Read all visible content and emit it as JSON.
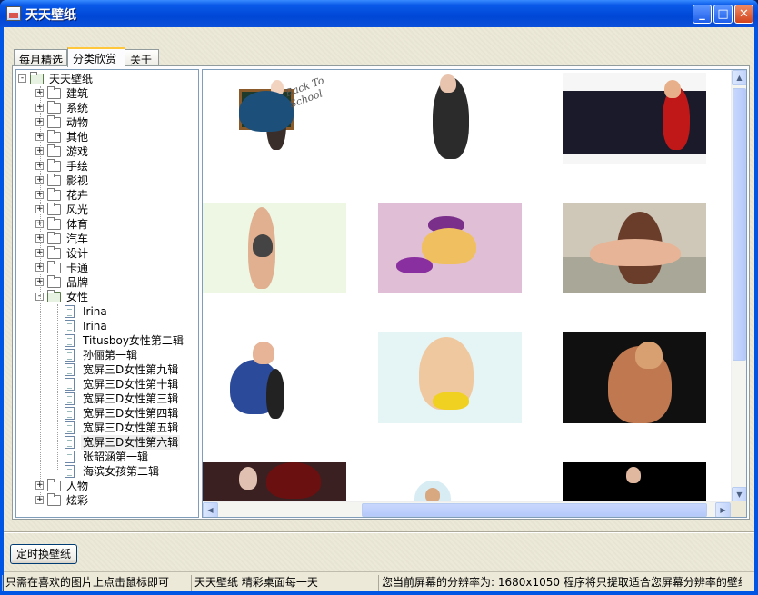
{
  "window": {
    "title": "天天壁纸",
    "minimize_glyph": "_",
    "maximize_glyph": "□",
    "close_glyph": "✕"
  },
  "tabs": [
    {
      "label": "每月精选"
    },
    {
      "label": "分类欣赏"
    },
    {
      "label": "关于"
    }
  ],
  "tree": {
    "root": "天天壁纸",
    "categories": [
      "建筑",
      "系统",
      "动物",
      "其他",
      "游戏",
      "手绘",
      "影视",
      "花卉",
      "风光",
      "体育",
      "汽车",
      "设计",
      "卡通",
      "品牌"
    ],
    "expanded": {
      "label": "女性",
      "children": [
        "Irina",
        "Irina",
        "Titusboy女性第二辑",
        "孙俪第一辑",
        "宽屏三D女性第九辑",
        "宽屏三D女性第十辑",
        "宽屏三D女性第三辑",
        "宽屏三D女性第四辑",
        "宽屏三D女性第五辑",
        "宽屏三D女性第六辑",
        "张韶涵第一辑",
        "海滨女孩第二辑"
      ],
      "selected_index": 9
    },
    "after": [
      "人物",
      "炫彩"
    ]
  },
  "gallery": {
    "thumbnails": [
      {
        "name": "back-to-school",
        "caption": "Back To School",
        "bg": "#ffffff"
      },
      {
        "name": "corset-woman",
        "bg": "#ffffff"
      },
      {
        "name": "police-car-girl",
        "bg": "#f6f6f6"
      },
      {
        "name": "dancer-green",
        "bg": "#eef7e4"
      },
      {
        "name": "purple-hat-girl",
        "bg": "#e0bfd6"
      },
      {
        "name": "curtain-pose",
        "bg": "#a9a898"
      },
      {
        "name": "chair-pose",
        "bg": "#ffffff"
      },
      {
        "name": "mask-girl",
        "bg": "#e5f5f5"
      },
      {
        "name": "dark-smoke-girl",
        "bg": "#2a2a2a"
      },
      {
        "name": "demon-wings",
        "bg": "#c9b9b9"
      },
      {
        "name": "bubble-girl",
        "bg": "#ffffff"
      },
      {
        "name": "black-bg-girl",
        "bg": "#050505"
      }
    ]
  },
  "timer_button": "定时换壁纸",
  "status": {
    "hint": "只需在喜欢的图片上点击鼠标即可",
    "slogan": "天天壁纸 精彩桌面每一天",
    "resolution": "您当前屏幕的分辨率为: 1680x1050 程序将只提取适合您屏幕分辨率的壁纸"
  },
  "scrollbar_glyphs": {
    "up": "▲",
    "down": "▼",
    "left": "◀",
    "right": "▶"
  }
}
